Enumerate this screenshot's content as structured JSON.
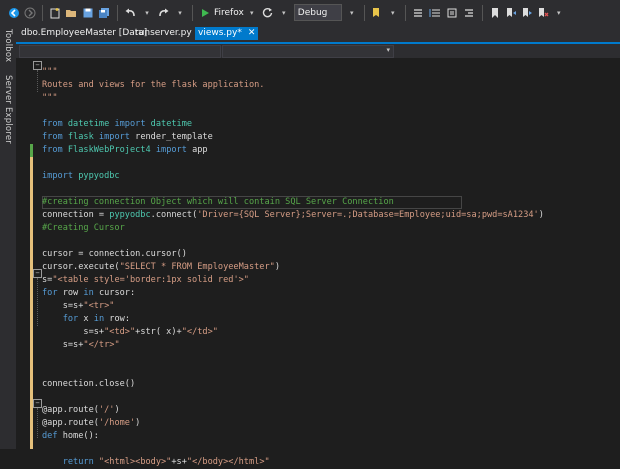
{
  "toolbar": {
    "browser_label": "Firefox",
    "config_label": "Debug"
  },
  "side_panels": [
    "Toolbox",
    "Server Explorer"
  ],
  "tabs": [
    {
      "label": "dbo.EmployeeMaster [Data]"
    },
    {
      "label": "runserver.py"
    },
    {
      "label": "views.py*",
      "close": "✕"
    }
  ],
  "code": [
    [
      {
        "t": "\"\"\"",
        "c": "str"
      }
    ],
    [
      {
        "t": "Routes and views for the flask application.",
        "c": "str"
      }
    ],
    [
      {
        "t": "\"\"\"",
        "c": "str"
      }
    ],
    [],
    [
      {
        "t": "from ",
        "c": "kw"
      },
      {
        "t": "datetime ",
        "c": "mod"
      },
      {
        "t": "import ",
        "c": "kw"
      },
      {
        "t": "datetime",
        "c": "mod"
      }
    ],
    [
      {
        "t": "from ",
        "c": "kw"
      },
      {
        "t": "flask ",
        "c": "mod"
      },
      {
        "t": "import ",
        "c": "kw"
      },
      {
        "t": "render_template",
        "c": "id"
      }
    ],
    [
      {
        "t": "from ",
        "c": "kw"
      },
      {
        "t": "FlaskWebProject4 ",
        "c": "mod"
      },
      {
        "t": "import ",
        "c": "kw"
      },
      {
        "t": "app",
        "c": "id"
      }
    ],
    [],
    [
      {
        "t": "import ",
        "c": "kw"
      },
      {
        "t": "pypyodbc",
        "c": "mod"
      }
    ],
    [],
    [
      {
        "t": "#creating connection Object which will contain SQL Server Connection",
        "c": "cm"
      }
    ],
    [
      {
        "t": "connection = ",
        "c": "id"
      },
      {
        "t": "pypyodbc",
        "c": "mod"
      },
      {
        "t": ".connect(",
        "c": "id"
      },
      {
        "t": "'Driver={SQL Server};Server=.;Database=Employee;uid=sa;pwd=sA1234'",
        "c": "str"
      },
      {
        "t": ")",
        "c": "id"
      }
    ],
    [
      {
        "t": "#Creating Cursor",
        "c": "cm"
      }
    ],
    [],
    [
      {
        "t": "cursor = connection.cursor()",
        "c": "id"
      }
    ],
    [
      {
        "t": "cursor.execute(",
        "c": "id"
      },
      {
        "t": "\"SELECT * FROM EmployeeMaster\"",
        "c": "str"
      },
      {
        "t": ")",
        "c": "id"
      }
    ],
    [
      {
        "t": "s=",
        "c": "id"
      },
      {
        "t": "\"<table style='border:1px solid red'>\"",
        "c": "str"
      }
    ],
    [
      {
        "t": "for ",
        "c": "kw"
      },
      {
        "t": "row ",
        "c": "id"
      },
      {
        "t": "in ",
        "c": "kw"
      },
      {
        "t": "cursor:",
        "c": "id"
      }
    ],
    [
      {
        "t": "    s=s+",
        "c": "id"
      },
      {
        "t": "\"<tr>\"",
        "c": "str"
      }
    ],
    [
      {
        "t": "    for ",
        "c": "kw"
      },
      {
        "t": "x ",
        "c": "id"
      },
      {
        "t": "in ",
        "c": "kw"
      },
      {
        "t": "row:",
        "c": "id"
      }
    ],
    [
      {
        "t": "        s=s+",
        "c": "id"
      },
      {
        "t": "\"<td>\"",
        "c": "str"
      },
      {
        "t": "+str( x)+",
        "c": "id"
      },
      {
        "t": "\"</td>\"",
        "c": "str"
      }
    ],
    [
      {
        "t": "    s=s+",
        "c": "id"
      },
      {
        "t": "\"</tr>\"",
        "c": "str"
      }
    ],
    [],
    [],
    [
      {
        "t": "connection.close()",
        "c": "id"
      }
    ],
    [],
    [
      {
        "t": "@app.route(",
        "c": "id"
      },
      {
        "t": "'/'",
        "c": "str"
      },
      {
        "t": ")",
        "c": "id"
      }
    ],
    [
      {
        "t": "@app.route(",
        "c": "id"
      },
      {
        "t": "'/home'",
        "c": "str"
      },
      {
        "t": ")",
        "c": "id"
      }
    ],
    [
      {
        "t": "def ",
        "c": "kw"
      },
      {
        "t": "home():",
        "c": "id"
      }
    ],
    [],
    [
      {
        "t": "    return ",
        "c": "kw"
      },
      {
        "t": "\"<html><body>\"",
        "c": "str"
      },
      {
        "t": "+s+",
        "c": "id"
      },
      {
        "t": "\"</body></html>\"",
        "c": "str"
      }
    ]
  ]
}
